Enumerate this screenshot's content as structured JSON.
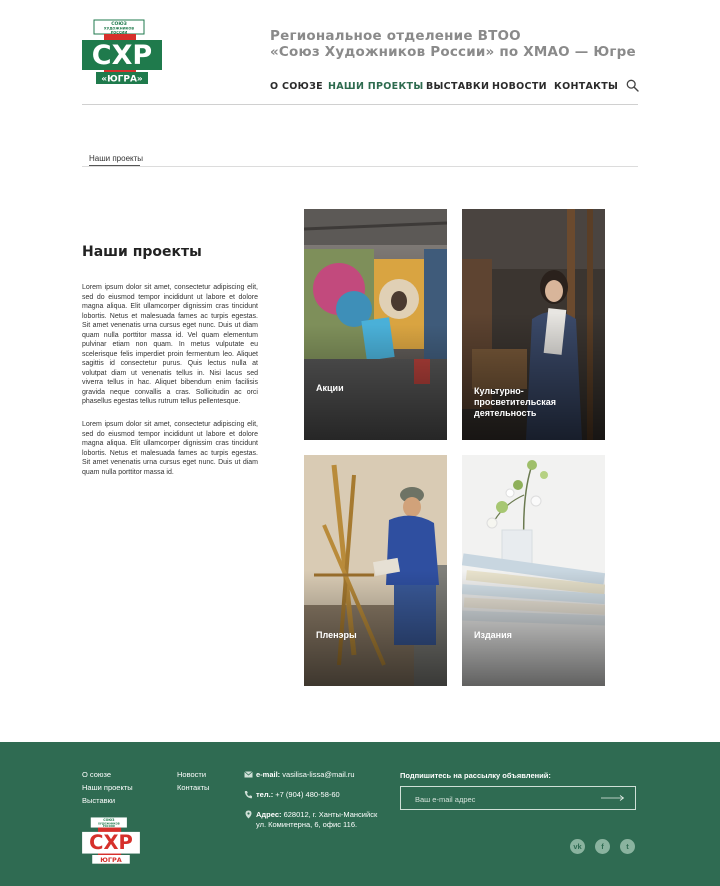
{
  "header": {
    "logo": {
      "top_text": "СОЮЗ ХУДОЖНИКОВ РОССИИ",
      "main_text": "СХР",
      "sub_text": "«ЮГРА»"
    },
    "title_line1": "Региональное отделение ВТОО",
    "title_line2": "«Союз Художников России» по ХМАО — Югре",
    "nav": [
      {
        "label": "О СОЮЗЕ"
      },
      {
        "label": "НАШИ ПРОЕКТЫ"
      },
      {
        "label": "ВЫСТАВКИ"
      },
      {
        "label": "НОВОСТИ"
      },
      {
        "label": "КОНТАКТЫ"
      }
    ],
    "search_icon": "search-icon"
  },
  "breadcrumb": {
    "current": "Наши проекты"
  },
  "main": {
    "title": "Наши проекты",
    "paragraph1": "Lorem ipsum dolor sit amet, consectetur adipiscing elit, sed do eiusmod tempor incididunt ut labore et dolore magna aliqua. Elit ullamcorper dignissim cras tincidunt lobortis. Netus et malesuada fames ac turpis egestas. Sit amet venenatis urna cursus eget nunc. Duis ut diam quam nulla porttitor massa id. Vel quam elementum pulvinar etiam non quam. In metus vulputate eu scelerisque felis imperdiet proin fermentum leo. Aliquet sagittis id consectetur purus. Quis lectus nulla at volutpat diam ut venenatis tellus in. Nisi lacus sed viverra tellus in hac. Aliquet bibendum enim facilisis gravida neque convallis a cras. Sollicitudin ac orci phasellus egestas tellus rutrum tellus pellentesque.",
    "paragraph2": "Lorem ipsum dolor sit amet, consectetur adipiscing elit, sed do eiusmod tempor incididunt ut labore et dolore magna aliqua. Elit ullamcorper dignissim cras tincidunt lobortis. Netus et malesuada fames ac turpis egestas. Sit amet venenatis urna cursus eget nunc. Duis ut diam quam nulla porttitor massa id."
  },
  "projects": [
    {
      "label": "Акции"
    },
    {
      "label": "Культурно-просветительская деятельность"
    },
    {
      "label": "Пленэры"
    },
    {
      "label": "Издания"
    }
  ],
  "footer": {
    "links_col1": [
      "О союзе",
      "Наши проекты",
      "Выставки"
    ],
    "links_col2": [
      "Новости",
      "Контакты"
    ],
    "email_label": "e-mail:",
    "email_value": "vasilisa-lissa@mail.ru",
    "phone_label": "тел.:",
    "phone_value": "+7 (904) 480-58-60",
    "address_label": "Адрес:",
    "address_line1": "628012, г. Ханты-Мансийск",
    "address_line2": "ул. Коминтерна, 6, офис 116.",
    "subscribe_title": "Подпишитесь на рассылку объявлений:",
    "subscribe_placeholder": "Ваш e-mail адрес",
    "social": [
      {
        "icon": "vk-icon",
        "glyph": "vk"
      },
      {
        "icon": "facebook-icon",
        "glyph": "f"
      },
      {
        "icon": "twitter-icon",
        "glyph": "t"
      }
    ]
  },
  "colors": {
    "brand_green": "#2f6b52",
    "logo_red": "#d6302b",
    "logo_green": "#1f7a4c",
    "nav_active": "#2e6b4f"
  }
}
